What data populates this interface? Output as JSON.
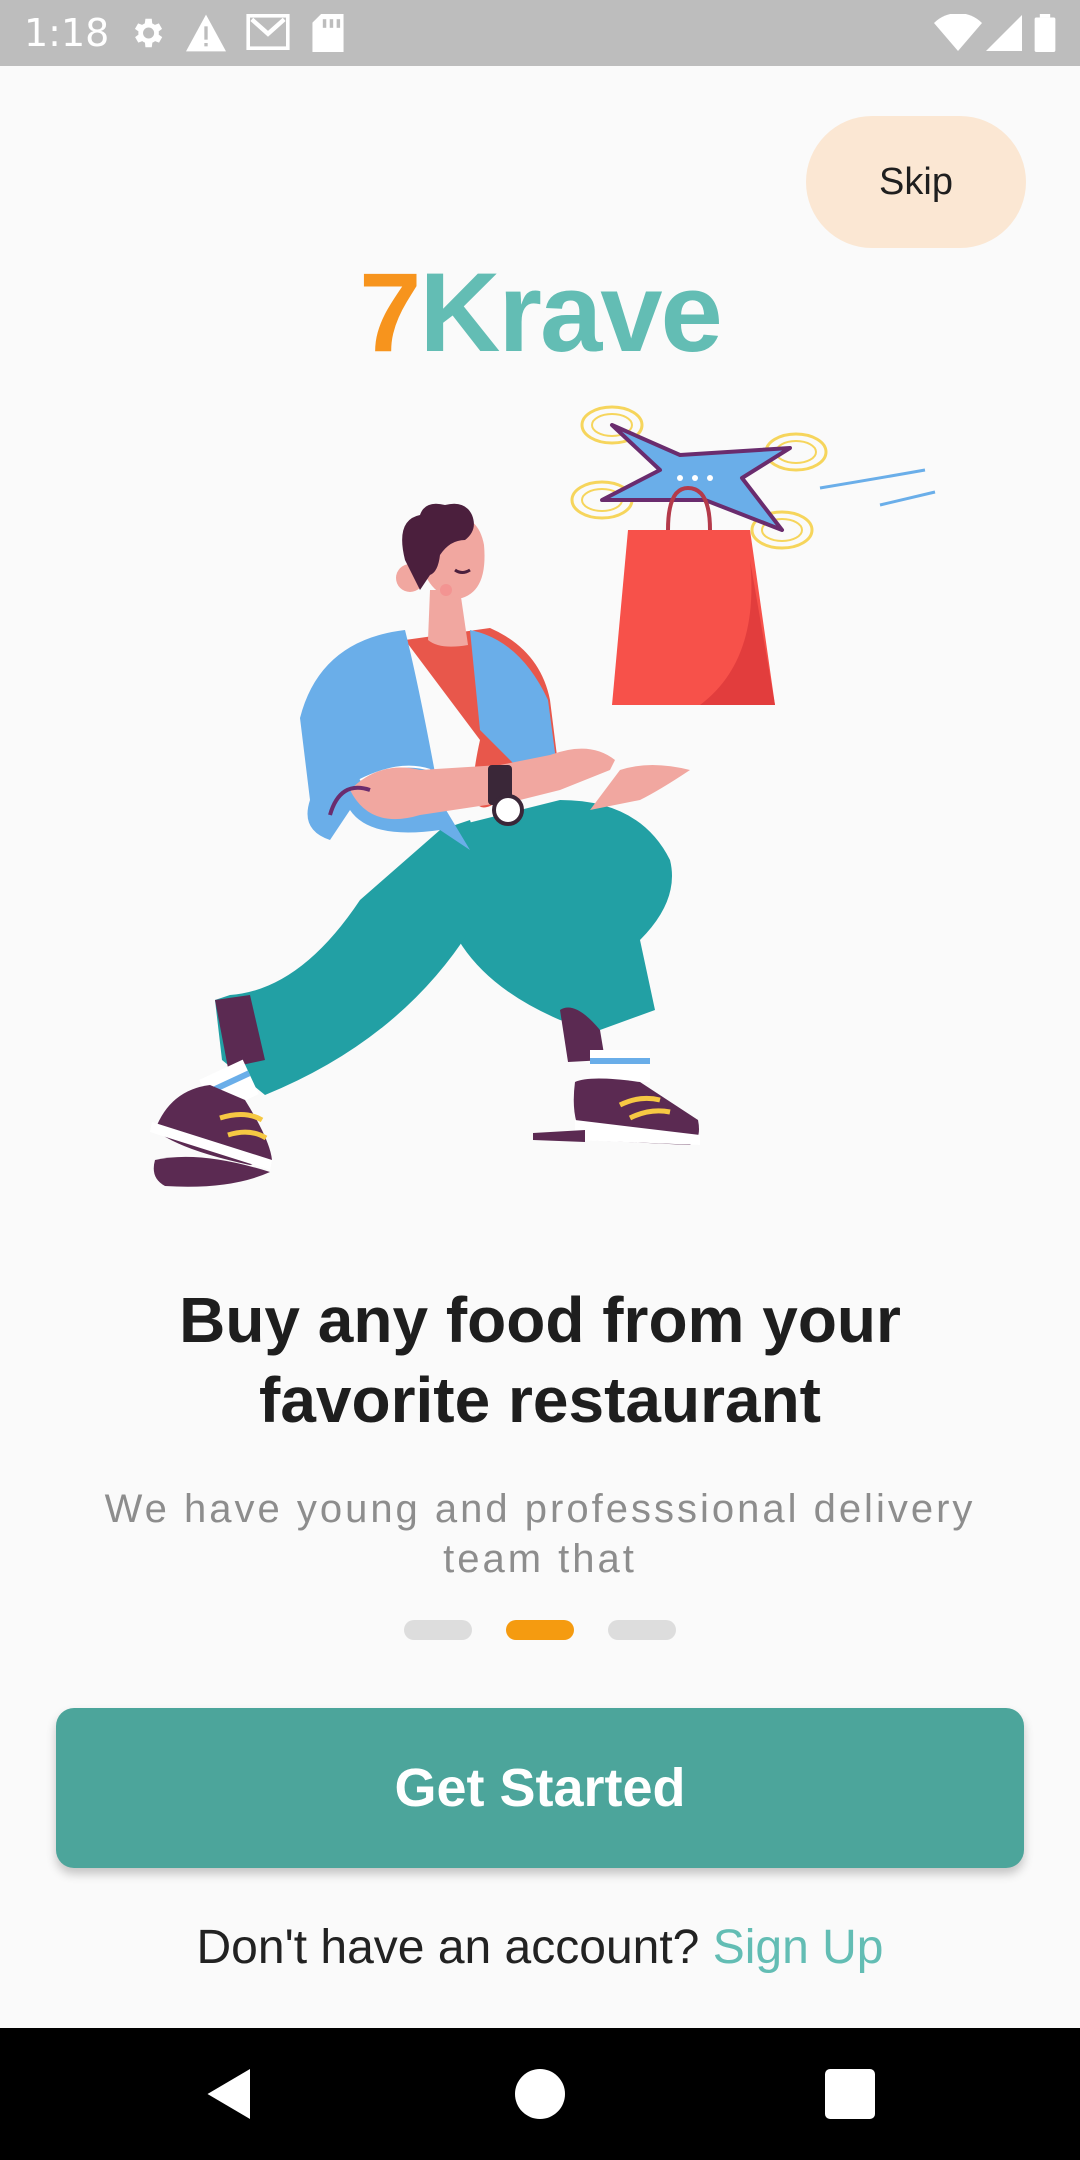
{
  "status_bar": {
    "time": "1:18",
    "icons": [
      "settings-icon",
      "warning-icon",
      "gmail-icon",
      "sd-card-icon",
      "wifi-icon",
      "signal-icon",
      "battery-icon"
    ]
  },
  "skip": {
    "label": "Skip"
  },
  "logo": {
    "number": "7",
    "word": "Krave"
  },
  "onboarding": {
    "title": "Buy any food from your favorite restaurant",
    "subtitle": "We have young and professsional delivery team that",
    "page_indicator": {
      "current": 2,
      "total": 3
    }
  },
  "get_started": {
    "label": "Get Started"
  },
  "signup": {
    "prompt": "Don't have an account?",
    "link": "Sign Up"
  },
  "colors": {
    "accent_teal": "#4ca59b",
    "logo_teal": "#63bdb4",
    "logo_orange": "#f7941d",
    "active_dot": "#f59b10",
    "skip_bg": "#fbe7d3"
  },
  "nav_bar": {
    "buttons": [
      "back-icon",
      "home-icon",
      "recents-icon"
    ]
  }
}
